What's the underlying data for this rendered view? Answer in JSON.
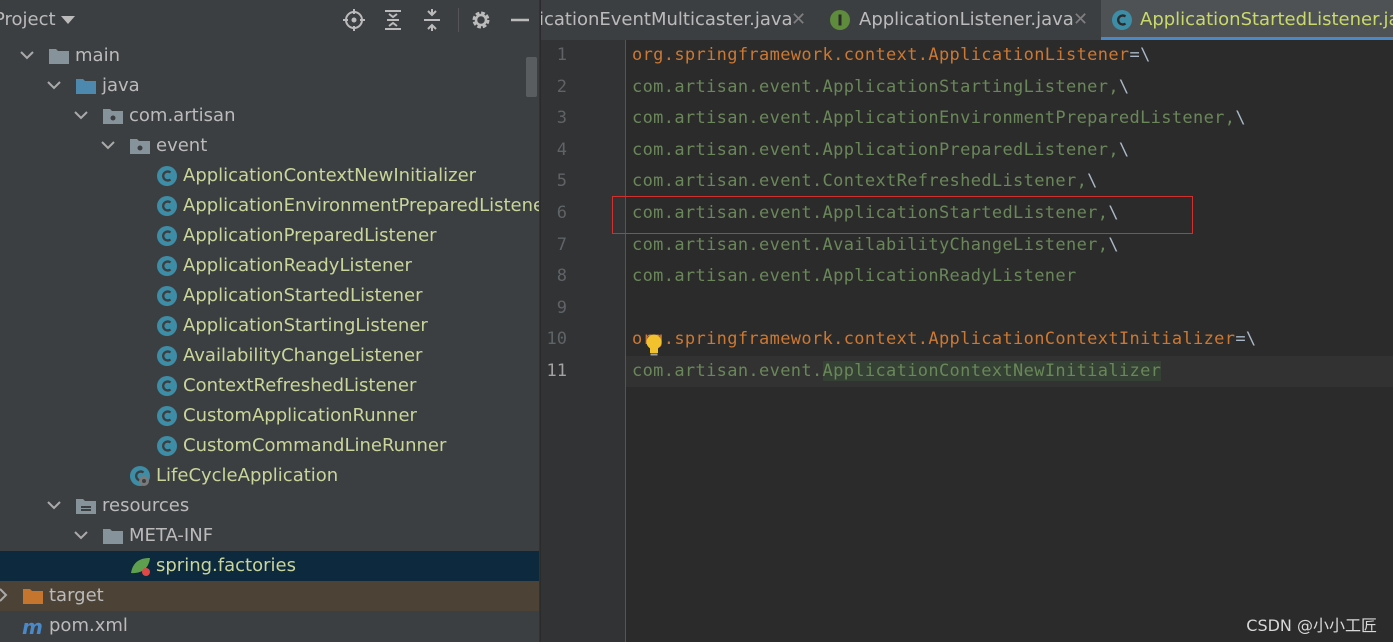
{
  "project_panel": {
    "title": "Project",
    "tree": [
      {
        "label": "main",
        "type": "folder"
      },
      {
        "label": "java",
        "type": "source-folder"
      },
      {
        "label": "com.artisan",
        "type": "package"
      },
      {
        "label": "event",
        "type": "package"
      },
      {
        "label": "ApplicationContextNewInitializer",
        "type": "class"
      },
      {
        "label": "ApplicationEnvironmentPreparedListener",
        "type": "class"
      },
      {
        "label": "ApplicationPreparedListener",
        "type": "class"
      },
      {
        "label": "ApplicationReadyListener",
        "type": "class"
      },
      {
        "label": "ApplicationStartedListener",
        "type": "class"
      },
      {
        "label": "ApplicationStartingListener",
        "type": "class"
      },
      {
        "label": "AvailabilityChangeListener",
        "type": "class"
      },
      {
        "label": "ContextRefreshedListener",
        "type": "class"
      },
      {
        "label": "CustomApplicationRunner",
        "type": "class"
      },
      {
        "label": "CustomCommandLineRunner",
        "type": "class"
      },
      {
        "label": "LifeCycleApplication",
        "type": "spring-boot-class"
      },
      {
        "label": "resources",
        "type": "resources-folder"
      },
      {
        "label": "META-INF",
        "type": "folder"
      },
      {
        "label": "spring.factories",
        "type": "spring-file",
        "selected": true
      },
      {
        "label": "target",
        "type": "excluded-folder"
      },
      {
        "label": "pom.xml",
        "type": "maven-file"
      }
    ]
  },
  "tabs": [
    {
      "label": "ApplicationEventMulticaster.java",
      "visible_label": "icationEventMulticaster.java",
      "close": "✕",
      "icon": "none"
    },
    {
      "label": "ApplicationListener.java",
      "close": "✕",
      "icon": "interface-icon"
    },
    {
      "label": "ApplicationStartedListener.java",
      "visible_label": "ApplicationStartedListener.jav",
      "icon": "class-icon",
      "active": true
    }
  ],
  "editor": {
    "lines": [
      {
        "num": "1",
        "key": "org.springframework.context.ApplicationListener",
        "op": "=\\",
        "val": "",
        "tail": ""
      },
      {
        "num": "2",
        "key": "",
        "op": "",
        "val": "com.artisan.event.ApplicationStartingListener,",
        "tail": "\\"
      },
      {
        "num": "3",
        "key": "",
        "op": "",
        "val": "com.artisan.event.ApplicationEnvironmentPreparedListener,",
        "tail": "\\"
      },
      {
        "num": "4",
        "key": "",
        "op": "",
        "val": "com.artisan.event.ApplicationPreparedListener,",
        "tail": "\\"
      },
      {
        "num": "5",
        "key": "",
        "op": "",
        "val": "com.artisan.event.ContextRefreshedListener,",
        "tail": "\\"
      },
      {
        "num": "6",
        "key": "",
        "op": "",
        "val": "com.artisan.event.ApplicationStartedListener,",
        "tail": "\\"
      },
      {
        "num": "7",
        "key": "",
        "op": "",
        "val": "com.artisan.event.AvailabilityChangeListener,",
        "tail": "\\"
      },
      {
        "num": "8",
        "key": "",
        "op": "",
        "val": "com.artisan.event.ApplicationReadyListener",
        "tail": ""
      },
      {
        "num": "9",
        "key": "",
        "op": "",
        "val": "",
        "tail": ""
      },
      {
        "num": "10",
        "key": "org.springframework.context.ApplicationContextInitializer",
        "op": "=\\",
        "val": "",
        "tail": ""
      },
      {
        "num": "11",
        "key": "",
        "op": "",
        "val": "com.artisan.event.",
        "tail": "ApplicationContextNewInitializer"
      }
    ],
    "current_line": "11",
    "highlighted_line": "6"
  },
  "watermark": "CSDN @小小工匠",
  "colors": {
    "key": "#cc7832",
    "value": "#6a8759",
    "class_label": "#c9d59a",
    "selection": "#0d293e",
    "highlight_box": "#d0302e",
    "active_tab_text": "#cad96a"
  }
}
